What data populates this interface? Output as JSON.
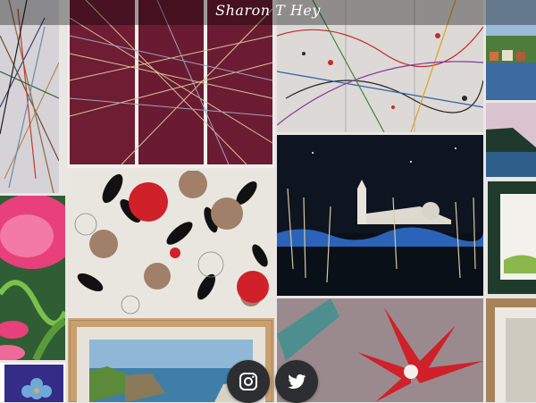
{
  "site": {
    "logo_text": "Sharon T Hey"
  },
  "social": [
    {
      "name": "instagram",
      "icon": "instagram-icon"
    },
    {
      "name": "twitter",
      "icon": "twitter-icon"
    }
  ],
  "gallery": {
    "colors": {
      "maroon": "#6e1d33",
      "navy": "#0e1420",
      "flower_red": "#d0202a",
      "flower_brown": "#a08069",
      "frame_wood": "#a8825a",
      "mat_green": "#1e3b2c"
    }
  }
}
